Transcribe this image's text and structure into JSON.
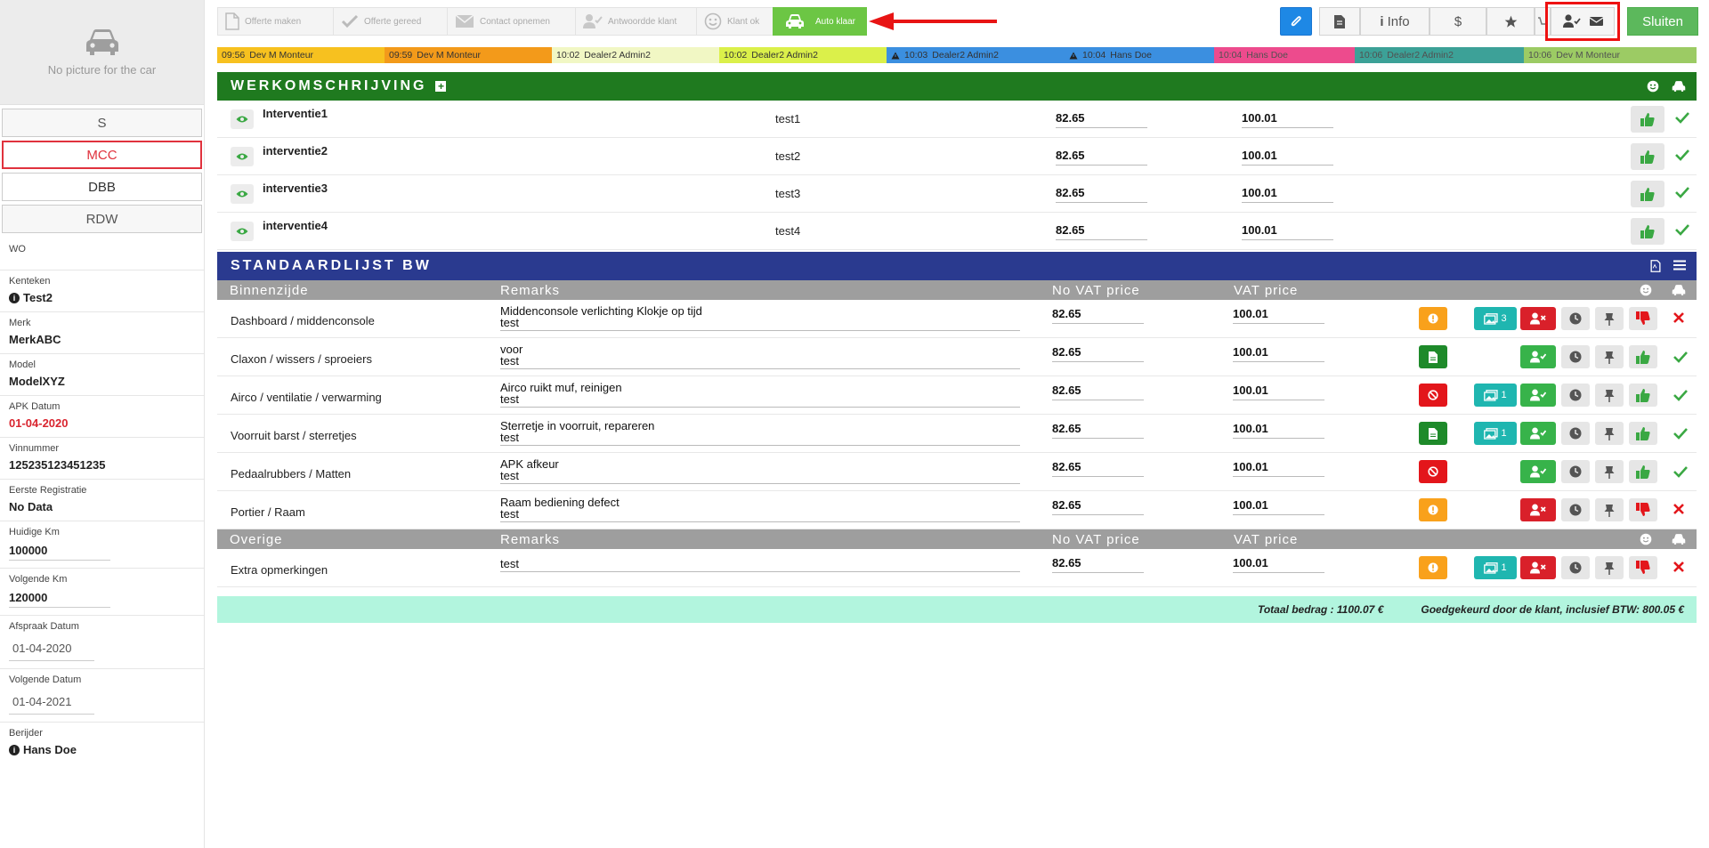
{
  "sidebar": {
    "no_picture": "No picture for the car",
    "buttons": [
      {
        "label": "S"
      },
      {
        "label": "MCC"
      },
      {
        "label": "DBB"
      },
      {
        "label": "RDW"
      }
    ],
    "fields": {
      "wo": {
        "label": "WO"
      },
      "kenteken": {
        "label": "Kenteken",
        "value": "Test2"
      },
      "merk": {
        "label": "Merk",
        "value": "MerkABC"
      },
      "model": {
        "label": "Model",
        "value": "ModelXYZ"
      },
      "apk": {
        "label": "APK Datum",
        "value": "01-04-2020"
      },
      "vin": {
        "label": "Vinnummer",
        "value": "125235123451235"
      },
      "eerste": {
        "label": "Eerste Registratie",
        "value": "No Data"
      },
      "huidige": {
        "label": "Huidige Km",
        "value": "100000"
      },
      "volgende_km": {
        "label": "Volgende Km",
        "value": "120000"
      },
      "afspraak": {
        "label": "Afspraak Datum",
        "value": "01-04-2020"
      },
      "volgende_datum": {
        "label": "Volgende Datum",
        "value": "01-04-2021"
      },
      "berijder": {
        "label": "Berijder",
        "value": "Hans Doe"
      }
    }
  },
  "steps": [
    {
      "label": "Offerte maken",
      "icon": "document-icon"
    },
    {
      "label": "Offerte gereed",
      "icon": "check-icon"
    },
    {
      "label": "Contact opnemen",
      "icon": "envelope-icon"
    },
    {
      "label": "Antwoordde klant",
      "icon": "user-check-icon"
    },
    {
      "label": "Klant ok",
      "icon": "smiley-icon"
    },
    {
      "label": "Auto klaar",
      "icon": "car-icon"
    }
  ],
  "toolbar": {
    "info_label": "Info",
    "sluiten_label": "Sluiten"
  },
  "timeline": [
    {
      "time": "09:56",
      "name": "Dev M Monteur",
      "color": "#f7c11f"
    },
    {
      "time": "09:59",
      "name": "Dev M Monteur",
      "color": "#f39a1a"
    },
    {
      "time": "10:02",
      "name": "Dealer2 Admin2",
      "color": "#f1f7c4"
    },
    {
      "time": "10:02",
      "name": "Dealer2 Admin2",
      "color": "#dbf04a"
    },
    {
      "time": "10:03",
      "name": "Dealer2 Admin2",
      "color": "#3b8fe0"
    },
    {
      "time": "10:04",
      "name": "Hans Doe",
      "color": "#3b8fe0"
    },
    {
      "time": "10:04",
      "name": "Hans Doe",
      "color": "#ea2c7a"
    },
    {
      "time": "10:06",
      "name": "Dealer2 Admin2",
      "color": "#1b9186"
    },
    {
      "time": "10:06",
      "name": "Dev M Monteur",
      "color": "#8bc34a"
    }
  ],
  "werk": {
    "title": "WERKOMSCHRIJVING",
    "rows": [
      {
        "name": "Interventie1",
        "remark": "test1",
        "novat": "82.65",
        "vat": "100.01"
      },
      {
        "name": "interventie2",
        "remark": "test2",
        "novat": "82.65",
        "vat": "100.01"
      },
      {
        "name": "interventie3",
        "remark": "test3",
        "novat": "82.65",
        "vat": "100.01"
      },
      {
        "name": "interventie4",
        "remark": "test4",
        "novat": "82.65",
        "vat": "100.01"
      }
    ]
  },
  "std": {
    "title": "STANDAARDLIJST BW",
    "head1": {
      "c1": "Binnenzijde",
      "c2": "Remarks",
      "c3": "No VAT price",
      "c4": "VAT price"
    },
    "rows": [
      {
        "name": "Dashboard / middenconsole",
        "r1": "Middenconsole verlichting Klokje op tijd",
        "r2": "test",
        "novat": "82.65",
        "vat": "100.01",
        "status": "warning",
        "photos": "3",
        "approve": "reject"
      },
      {
        "name": "Claxon / wissers / sproeiers",
        "r1": "voor",
        "r2": "test",
        "novat": "82.65",
        "vat": "100.01",
        "status": "doc",
        "photos": "",
        "approve": "accept"
      },
      {
        "name": "Airco / ventilatie / verwarming",
        "r1": "Airco ruikt muf, reinigen",
        "r2": "test",
        "novat": "82.65",
        "vat": "100.01",
        "status": "ban",
        "photos": "1",
        "approve": "accept"
      },
      {
        "name": "Voorruit barst / sterretjes",
        "r1": "Sterretje in voorruit, repareren",
        "r2": "test",
        "novat": "82.65",
        "vat": "100.01",
        "status": "doc",
        "photos": "1",
        "approve": "accept"
      },
      {
        "name": "Pedaalrubbers / Matten",
        "r1": "APK afkeur",
        "r2": "test",
        "novat": "82.65",
        "vat": "100.01",
        "status": "ban",
        "photos": "",
        "approve": "accept"
      },
      {
        "name": "Portier / Raam",
        "r1": "Raam bediening defect",
        "r2": "test",
        "novat": "82.65",
        "vat": "100.01",
        "status": "warning",
        "photos": "",
        "approve": "reject"
      }
    ],
    "head2": {
      "c1": "Overige",
      "c2": "Remarks",
      "c3": "No VAT price",
      "c4": "VAT price"
    },
    "extra": {
      "name": "Extra opmerkingen",
      "r1": "test",
      "novat": "82.65",
      "vat": "100.01",
      "status": "warning",
      "photos": "1",
      "approve": "reject"
    }
  },
  "totals": {
    "total": "Totaal bedrag : 1100.07 €",
    "approved": "Goedgekeurd door de klant, inclusief BTW: 800.05 €"
  },
  "colors": {
    "green_header": "#1f7a1f",
    "navy_header": "#2a3a8f",
    "accent_red": "#e0323d",
    "total_bar": "#b2f5de"
  }
}
